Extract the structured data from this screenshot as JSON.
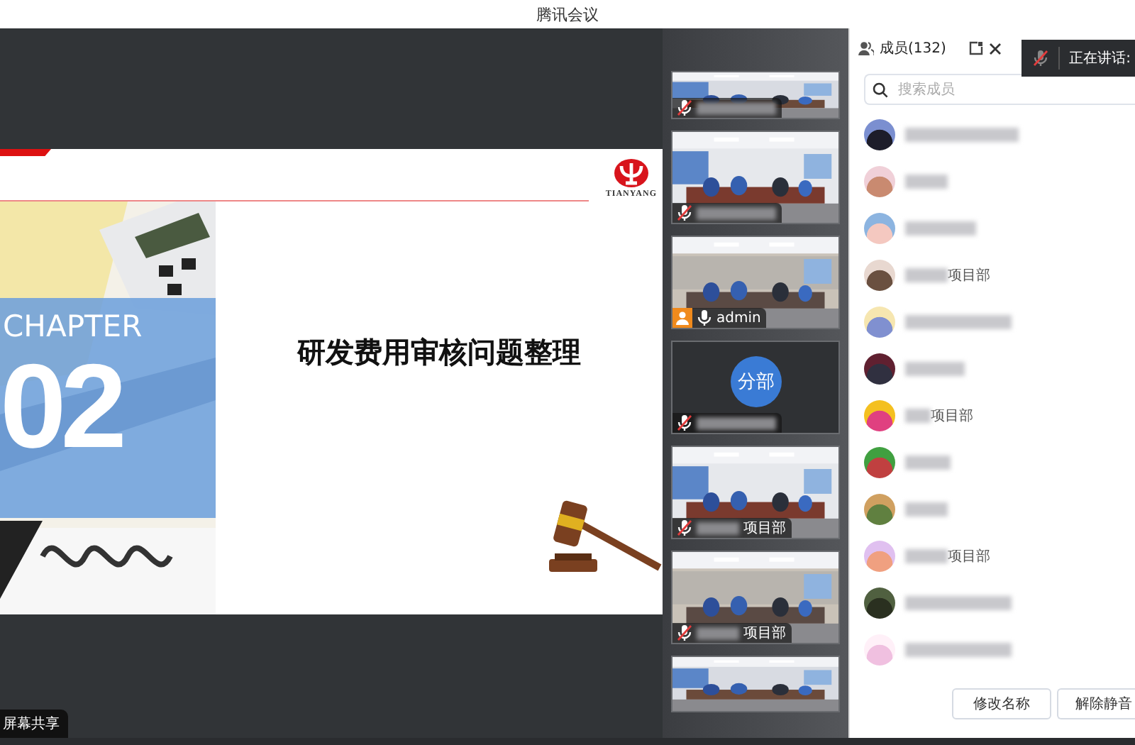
{
  "window": {
    "title": "腾讯会议"
  },
  "slide": {
    "logo_text": "TIANYANG",
    "chapter_label": "CHAPTER",
    "chapter_number": "02",
    "title": "研发费用审核问题整理"
  },
  "share_badge": "屏幕共享",
  "video_tiles": [
    {
      "kind": "video",
      "label": {
        "muted": true,
        "host": false
      }
    },
    {
      "kind": "video",
      "label": {
        "muted": true,
        "host": false
      }
    },
    {
      "kind": "video",
      "label": {
        "muted": false,
        "host": true,
        "name": "admin"
      }
    },
    {
      "kind": "avatar",
      "avatar_text": "分部",
      "label": {
        "muted": true,
        "host": false
      }
    },
    {
      "kind": "video",
      "label": {
        "muted": true,
        "host": false,
        "name": "项目部"
      }
    },
    {
      "kind": "video",
      "label": {
        "muted": true,
        "host": false,
        "name": "项目部"
      }
    },
    {
      "kind": "video"
    }
  ],
  "members_panel": {
    "title": "成员(132)",
    "search": {
      "placeholder": "搜索成员"
    },
    "members": [
      {
        "redacted": true
      },
      {
        "redacted": true
      },
      {
        "redacted": true
      },
      {
        "redacted": true,
        "name": "项目部"
      },
      {
        "redacted": true
      },
      {
        "redacted": true
      },
      {
        "redacted": true,
        "name": "项目部"
      },
      {
        "redacted": true
      },
      {
        "redacted": true
      },
      {
        "redacted": true,
        "name": "项目部"
      },
      {
        "redacted": true
      },
      {
        "redacted": true
      }
    ],
    "buttons": [
      "修改名称",
      "解除静音"
    ]
  },
  "speaking": {
    "label": "正在讲话:",
    "muted": true
  }
}
